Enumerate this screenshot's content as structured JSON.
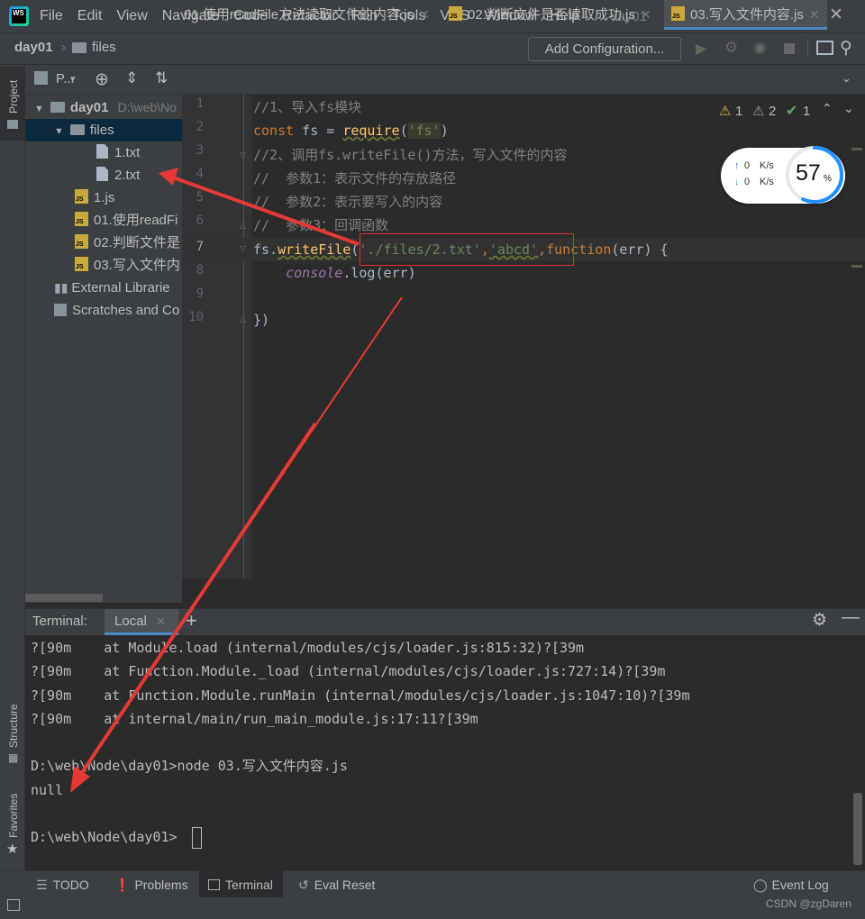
{
  "app": {
    "logo_text": "WS",
    "window_title": "day01"
  },
  "menu": [
    "File",
    "Edit",
    "View",
    "Navigate",
    "Code",
    "Refactor",
    "Run",
    "Tools",
    "VCS",
    "Window",
    "Help"
  ],
  "breadcrumb": {
    "project": "day01",
    "folder": "files"
  },
  "toolbar": {
    "add_config_label": "Add Configuration..."
  },
  "left_strip": {
    "project_label": "Project",
    "structure_label": "Structure",
    "favorites_label": "Favorites"
  },
  "project_panel": {
    "title": "P..."
  },
  "tree": [
    {
      "label": "day01",
      "extra": "D:\\web\\No",
      "type": "folder"
    },
    {
      "label": "files",
      "type": "folder"
    },
    {
      "label": "1.txt",
      "type": "txt"
    },
    {
      "label": "2.txt",
      "type": "txt"
    },
    {
      "label": "1.js",
      "type": "js"
    },
    {
      "label": "01.使用readFi",
      "type": "js"
    },
    {
      "label": "02.判断文件是",
      "type": "js"
    },
    {
      "label": "03.写入文件内",
      "type": "js"
    },
    {
      "label": "External Librarie",
      "type": "lib"
    },
    {
      "label": "Scratches and Co",
      "type": "scratch"
    }
  ],
  "tabs": [
    {
      "label": "01.使用readFile方法读取文件的内容.js"
    },
    {
      "label": "02.判断文件是否读取成功.js"
    },
    {
      "label": "03.写入文件内容.js"
    }
  ],
  "inspections": {
    "warnings": "1",
    "weak_warnings": "2",
    "ok": "1"
  },
  "line_numbers": [
    "1",
    "2",
    "3",
    "4",
    "5",
    "6",
    "7",
    "8",
    "9",
    "10"
  ],
  "code": {
    "l1": "//1、导入fs模块",
    "l2_kw": "const",
    "l2_var": " fs = ",
    "l2_fn": "require",
    "l2_p1": "(",
    "l2_str": "'fs'",
    "l2_p2": ")",
    "l3": "//2、调用fs.writeFile()方法，写入文件的内容",
    "l4": "//  参数1：表示文件的存放路径",
    "l5": "//  参数2：表示要写入的内容",
    "l6": "//  参数3：回调函数",
    "l7_a": "fs.",
    "l7_fn": "writeFile",
    "l7_p": "(",
    "l7_s1": "'./files/2.txt'",
    "l7_c": ",",
    "l7_s2": "'abcd'",
    "l7_c2": ",",
    "l7_kw": "function",
    "l7_rest": "(err) {",
    "l8_obj": "console",
    "l8_rest": ".log(err)",
    "l10": "})"
  },
  "network_widget": {
    "up": "0",
    "down": "0",
    "unit": "K/s",
    "percent": "57",
    "percent_sign": "%"
  },
  "terminal": {
    "title": "Terminal:",
    "tab": "Local",
    "lines": [
      "?[90m    at Module.load (internal/modules/cjs/loader.js:815:32)?[39m",
      "?[90m    at Function.Module._load (internal/modules/cjs/loader.js:727:14)?[39m",
      "?[90m    at Function.Module.runMain (internal/modules/cjs/loader.js:1047:10)?[39m",
      "?[90m    at internal/main/run_main_module.js:17:11?[39m",
      "",
      "D:\\web\\Node\\day01>node 03.写入文件内容.js",
      "null",
      "",
      "D:\\web\\Node\\day01>"
    ]
  },
  "bottom_tabs": [
    {
      "label": "TODO"
    },
    {
      "label": "Problems"
    },
    {
      "label": "Terminal"
    },
    {
      "label": "Eval Reset"
    },
    {
      "label": "Event Log"
    }
  ],
  "watermark": "CSDN @zgDaren",
  "colors": {
    "accent_red": "#e03030",
    "selection": "#0d293e"
  }
}
